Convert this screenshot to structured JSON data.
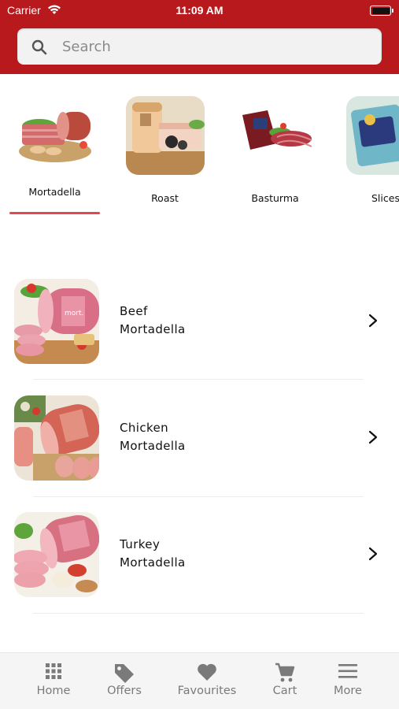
{
  "status_bar": {
    "carrier": "Carrier",
    "time": "11:09 AM"
  },
  "search": {
    "placeholder": "Search"
  },
  "categories": [
    {
      "label": "Mortadella",
      "active": true
    },
    {
      "label": "Roast",
      "active": false
    },
    {
      "label": "Basturma",
      "active": false
    },
    {
      "label": "Slices",
      "active": false
    }
  ],
  "products": [
    {
      "line1": "Beef",
      "line2": "Mortadella"
    },
    {
      "line1": "Chicken",
      "line2": "Mortadella"
    },
    {
      "line1": "Turkey",
      "line2": "Mortadella"
    }
  ],
  "tabs": [
    {
      "label": "Home",
      "icon": "grid-icon"
    },
    {
      "label": "Offers",
      "icon": "tag-icon"
    },
    {
      "label": "Favourites",
      "icon": "heart-icon"
    },
    {
      "label": "Cart",
      "icon": "cart-icon"
    },
    {
      "label": "More",
      "icon": "menu-icon"
    }
  ],
  "colors": {
    "header": "#b8191c",
    "accent_underline": "#e3474f",
    "tab_inactive": "#7a7a7a"
  }
}
